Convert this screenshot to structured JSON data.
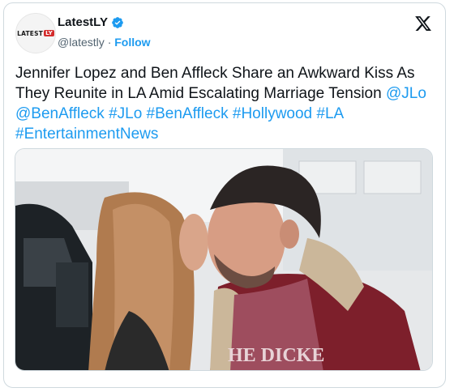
{
  "account": {
    "display_name": "LatestLY",
    "handle": "@latestly",
    "separator": "·",
    "follow_label": "Follow",
    "avatar_text": "LATEST",
    "avatar_badge": "LY"
  },
  "tweet": {
    "text": "Jennifer Lopez and Ben Affleck Share an Awkward Kiss As They Reunite in LA Amid Escalating Marriage Tension",
    "hashtags": [
      "@JLo",
      "@BenAffleck",
      "#JLo",
      "#BenAffleck",
      "#Hollywood",
      "#LA",
      "#EntertainmentNews"
    ]
  },
  "media": {
    "shirt_text": "HE DICKE"
  },
  "colors": {
    "accent": "#1d9bf0",
    "text": "#0f1419",
    "muted": "#536471",
    "border": "#cfd9de"
  },
  "icons": [
    "verified-badge-icon",
    "x-logo-icon"
  ]
}
